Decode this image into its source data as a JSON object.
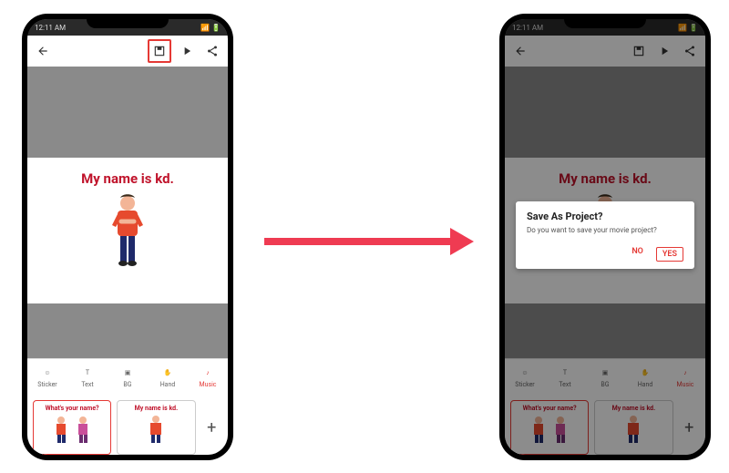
{
  "status": {
    "time": "12:11 AM",
    "carrier": "••",
    "signal": "📶",
    "battery": "80"
  },
  "canvas": {
    "title": "My name is kd."
  },
  "tools": {
    "sticker": "Sticker",
    "text": "Text",
    "bg": "BG",
    "hand": "Hand",
    "music": "Music"
  },
  "clips": {
    "first": "What's your name?",
    "second": "My name is kd."
  },
  "dialog": {
    "title": "Save As Project?",
    "body": "Do you want to save your movie project?",
    "no": "NO",
    "yes": "YES"
  }
}
